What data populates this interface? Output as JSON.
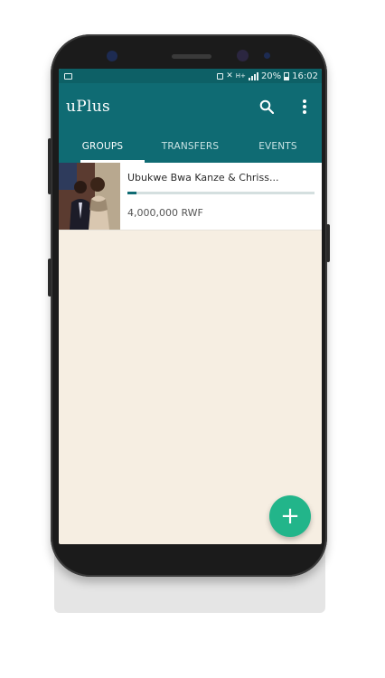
{
  "status_bar": {
    "battery": "20%",
    "time": "16:02",
    "network": "H+"
  },
  "app": {
    "title": "uPlus"
  },
  "appbar": {
    "search_icon": "search-icon",
    "menu_icon": "more-vert-icon"
  },
  "tabs": [
    {
      "label": "GROUPS",
      "active": true
    },
    {
      "label": "TRANSFERS",
      "active": false
    },
    {
      "label": "EVENTS",
      "active": false
    }
  ],
  "groups": [
    {
      "title": "Ubukwe Bwa Kanze & Chriss...",
      "amount": "4,000,000 RWF",
      "progress": 0.05
    }
  ],
  "fab": {
    "label": "+"
  },
  "colors": {
    "primary": "#0f6b73",
    "primary_dark": "#0d6066",
    "accent": "#22b58a",
    "background": "#f6eee2"
  }
}
